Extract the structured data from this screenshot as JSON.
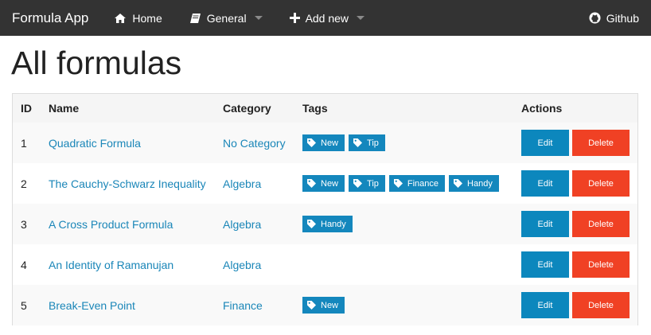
{
  "navbar": {
    "brand": "Formula App",
    "home": {
      "label": "Home",
      "icon": "home-icon"
    },
    "general": {
      "label": "General",
      "icon": "book-icon"
    },
    "add_new": {
      "label": "Add new",
      "icon": "plus-icon"
    },
    "github": {
      "label": "Github",
      "icon": "github-icon"
    }
  },
  "page": {
    "title": "All formulas"
  },
  "table": {
    "headers": {
      "id": "ID",
      "name": "Name",
      "category": "Category",
      "tags": "Tags",
      "actions": "Actions"
    },
    "rows": [
      {
        "id": "1",
        "name": "Quadratic Formula",
        "category": "No Category",
        "tags": [
          "New",
          "Tip"
        ]
      },
      {
        "id": "2",
        "name": "The Cauchy-Schwarz Inequality",
        "category": "Algebra",
        "tags": [
          "New",
          "Tip",
          "Finance",
          "Handy"
        ]
      },
      {
        "id": "3",
        "name": "A Cross Product Formula",
        "category": "Algebra",
        "tags": [
          "Handy"
        ]
      },
      {
        "id": "4",
        "name": "An Identity of Ramanujan",
        "category": "Algebra",
        "tags": []
      },
      {
        "id": "5",
        "name": "Break-Even Point",
        "category": "Finance",
        "tags": [
          "New"
        ]
      }
    ],
    "edit_label": "Edit",
    "delete_label": "Delete"
  },
  "colors": {
    "navbar_bg": "#333333",
    "link": "#1a86b8",
    "tag_bg": "#1487bd",
    "edit_bg": "#0c87bd",
    "delete_bg": "#f04124"
  }
}
